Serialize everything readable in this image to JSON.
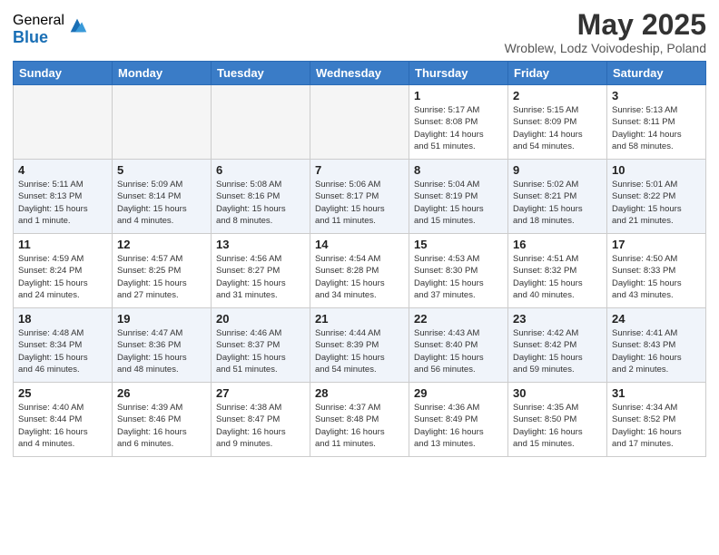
{
  "logo": {
    "general": "General",
    "blue": "Blue"
  },
  "title": "May 2025",
  "location": "Wroblew, Lodz Voivodeship, Poland",
  "weekdays": [
    "Sunday",
    "Monday",
    "Tuesday",
    "Wednesday",
    "Thursday",
    "Friday",
    "Saturday"
  ],
  "weeks": [
    [
      {
        "day": "",
        "info": ""
      },
      {
        "day": "",
        "info": ""
      },
      {
        "day": "",
        "info": ""
      },
      {
        "day": "",
        "info": ""
      },
      {
        "day": "1",
        "info": "Sunrise: 5:17 AM\nSunset: 8:08 PM\nDaylight: 14 hours\nand 51 minutes."
      },
      {
        "day": "2",
        "info": "Sunrise: 5:15 AM\nSunset: 8:09 PM\nDaylight: 14 hours\nand 54 minutes."
      },
      {
        "day": "3",
        "info": "Sunrise: 5:13 AM\nSunset: 8:11 PM\nDaylight: 14 hours\nand 58 minutes."
      }
    ],
    [
      {
        "day": "4",
        "info": "Sunrise: 5:11 AM\nSunset: 8:13 PM\nDaylight: 15 hours\nand 1 minute."
      },
      {
        "day": "5",
        "info": "Sunrise: 5:09 AM\nSunset: 8:14 PM\nDaylight: 15 hours\nand 4 minutes."
      },
      {
        "day": "6",
        "info": "Sunrise: 5:08 AM\nSunset: 8:16 PM\nDaylight: 15 hours\nand 8 minutes."
      },
      {
        "day": "7",
        "info": "Sunrise: 5:06 AM\nSunset: 8:17 PM\nDaylight: 15 hours\nand 11 minutes."
      },
      {
        "day": "8",
        "info": "Sunrise: 5:04 AM\nSunset: 8:19 PM\nDaylight: 15 hours\nand 15 minutes."
      },
      {
        "day": "9",
        "info": "Sunrise: 5:02 AM\nSunset: 8:21 PM\nDaylight: 15 hours\nand 18 minutes."
      },
      {
        "day": "10",
        "info": "Sunrise: 5:01 AM\nSunset: 8:22 PM\nDaylight: 15 hours\nand 21 minutes."
      }
    ],
    [
      {
        "day": "11",
        "info": "Sunrise: 4:59 AM\nSunset: 8:24 PM\nDaylight: 15 hours\nand 24 minutes."
      },
      {
        "day": "12",
        "info": "Sunrise: 4:57 AM\nSunset: 8:25 PM\nDaylight: 15 hours\nand 27 minutes."
      },
      {
        "day": "13",
        "info": "Sunrise: 4:56 AM\nSunset: 8:27 PM\nDaylight: 15 hours\nand 31 minutes."
      },
      {
        "day": "14",
        "info": "Sunrise: 4:54 AM\nSunset: 8:28 PM\nDaylight: 15 hours\nand 34 minutes."
      },
      {
        "day": "15",
        "info": "Sunrise: 4:53 AM\nSunset: 8:30 PM\nDaylight: 15 hours\nand 37 minutes."
      },
      {
        "day": "16",
        "info": "Sunrise: 4:51 AM\nSunset: 8:32 PM\nDaylight: 15 hours\nand 40 minutes."
      },
      {
        "day": "17",
        "info": "Sunrise: 4:50 AM\nSunset: 8:33 PM\nDaylight: 15 hours\nand 43 minutes."
      }
    ],
    [
      {
        "day": "18",
        "info": "Sunrise: 4:48 AM\nSunset: 8:34 PM\nDaylight: 15 hours\nand 46 minutes."
      },
      {
        "day": "19",
        "info": "Sunrise: 4:47 AM\nSunset: 8:36 PM\nDaylight: 15 hours\nand 48 minutes."
      },
      {
        "day": "20",
        "info": "Sunrise: 4:46 AM\nSunset: 8:37 PM\nDaylight: 15 hours\nand 51 minutes."
      },
      {
        "day": "21",
        "info": "Sunrise: 4:44 AM\nSunset: 8:39 PM\nDaylight: 15 hours\nand 54 minutes."
      },
      {
        "day": "22",
        "info": "Sunrise: 4:43 AM\nSunset: 8:40 PM\nDaylight: 15 hours\nand 56 minutes."
      },
      {
        "day": "23",
        "info": "Sunrise: 4:42 AM\nSunset: 8:42 PM\nDaylight: 15 hours\nand 59 minutes."
      },
      {
        "day": "24",
        "info": "Sunrise: 4:41 AM\nSunset: 8:43 PM\nDaylight: 16 hours\nand 2 minutes."
      }
    ],
    [
      {
        "day": "25",
        "info": "Sunrise: 4:40 AM\nSunset: 8:44 PM\nDaylight: 16 hours\nand 4 minutes."
      },
      {
        "day": "26",
        "info": "Sunrise: 4:39 AM\nSunset: 8:46 PM\nDaylight: 16 hours\nand 6 minutes."
      },
      {
        "day": "27",
        "info": "Sunrise: 4:38 AM\nSunset: 8:47 PM\nDaylight: 16 hours\nand 9 minutes."
      },
      {
        "day": "28",
        "info": "Sunrise: 4:37 AM\nSunset: 8:48 PM\nDaylight: 16 hours\nand 11 minutes."
      },
      {
        "day": "29",
        "info": "Sunrise: 4:36 AM\nSunset: 8:49 PM\nDaylight: 16 hours\nand 13 minutes."
      },
      {
        "day": "30",
        "info": "Sunrise: 4:35 AM\nSunset: 8:50 PM\nDaylight: 16 hours\nand 15 minutes."
      },
      {
        "day": "31",
        "info": "Sunrise: 4:34 AM\nSunset: 8:52 PM\nDaylight: 16 hours\nand 17 minutes."
      }
    ]
  ],
  "row_styles": [
    "normal",
    "alt",
    "normal",
    "alt",
    "normal"
  ]
}
